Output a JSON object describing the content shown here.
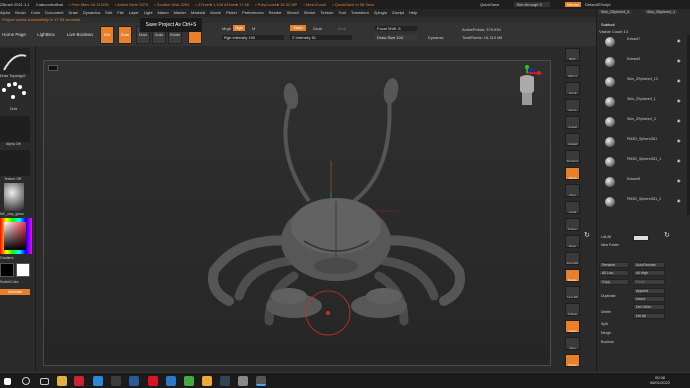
{
  "titlebar": {
    "app": "ZBrush 2021.1.1",
    "project": "Crabcontrofinal",
    "free_mem": "• Free Mem 16.312GB",
    "active_mem": "• Active Mem 3374",
    "scratch": "• Scratch Disk 3294",
    "ztime": "• ZTime►1.428 ATime►17.96",
    "polycount": "• PolyCount►15.32 MP",
    "meshcount": "• MeshCount",
    "quicksave_timer": "• QuickSave In 56 Secs",
    "quicksave_btn": "QuickSave",
    "seethrough": "See-through 0",
    "menus_btn": "Menus",
    "default_script": "DefaultZScript"
  },
  "menubar": [
    "Alpha",
    "Brush",
    "Color",
    "Document",
    "Draw",
    "Dynamics",
    "Edit",
    "File",
    "Layer",
    "Light",
    "Macro",
    "Marker",
    "Material",
    "Movie",
    "Picker",
    "Preferences",
    "Render",
    "Stencil",
    "Stroke",
    "Texture",
    "Tool",
    "Transform",
    "Zplugin",
    "Zscript",
    "Help"
  ],
  "notification": "Project saved successfully in 17.96 seconds.",
  "tooltip": "Save Project As  Ctrl+S",
  "toolshelf": {
    "tabs": [
      "Home Page",
      "LightBox",
      "Live Boolean"
    ],
    "edit": "Edit",
    "draw": "Draw",
    "move": "Move",
    "scale": "Scale",
    "rotate": "Rotate",
    "rgb": "Rgb",
    "rgb_intensity_label": "Rgb Intensity",
    "rgb_intensity_value": "100",
    "mrgb": "Mrgb",
    "m": "M",
    "zadd": "Zadd",
    "zsub": "Zsub",
    "zcut": "Zcut",
    "z_intensity_label": "Z Intensity",
    "z_intensity_value": "51",
    "focal_label": "Focal Shift",
    "focal_value": "-5",
    "draw_size_label": "Draw Size",
    "draw_size_value": "104",
    "dynamic": "Dynamic",
    "active_points": "ActivePoints: 379,930",
    "total_points": "TotalPoints: 15.313 Mil"
  },
  "leftpanel": {
    "brush_label": "Draw TopologyS",
    "dots_label": "Dots",
    "alpha_label": "Alpha Off",
    "texture_label": "Texture Off",
    "material_label": "MC_clay_gloss",
    "gradient_label": "Gradient",
    "switch_label": "SwitchColor",
    "alternate_label": "Alternate"
  },
  "rtoolbar": [
    "BPR",
    "SPix 3",
    "Scroll",
    "Zoom",
    "Actual",
    "AAHalf",
    "Dynamic",
    "Persp",
    "Floor",
    "Local",
    "Frame",
    "Move",
    "Zoom3D",
    "Rotate",
    "Line Fill",
    "Transp",
    "Ghost",
    "Solo",
    "Xpose"
  ],
  "rightpanel": {
    "tab1": "Skin_ZSphere4_5",
    "tab2": "Skin_ZSphere4_1",
    "subtool_header": "Subtool",
    "visible_count": "Visible Count 13",
    "subtools": [
      "Extract7",
      "Extract3",
      "Skin_ZSphere4_13",
      "Skin_ZSphere4_1",
      "Skin_ZSphere4_3",
      "PM3D_Sphere3D1",
      "PM3D_Sphere3D1_1",
      "Extract5",
      "PM3D_Sphere3D1_2"
    ],
    "list_all": "List All",
    "new_folder": "New Folder",
    "auto_reorder": "AutoReorder",
    "rename": "Rename",
    "all_low": "All Low",
    "all_high": "All High",
    "copy": "Copy",
    "paste": "Paste",
    "append": "Append",
    "duplicate": "Duplicate",
    "insert": "Insert",
    "del_other": "Del Other",
    "delete": "Delete",
    "del_all": "Del All",
    "split": "Split",
    "merge": "Merge",
    "boolean": "Boolean"
  },
  "taskbar": {
    "time": "00:38",
    "date": "06/01/2022"
  }
}
